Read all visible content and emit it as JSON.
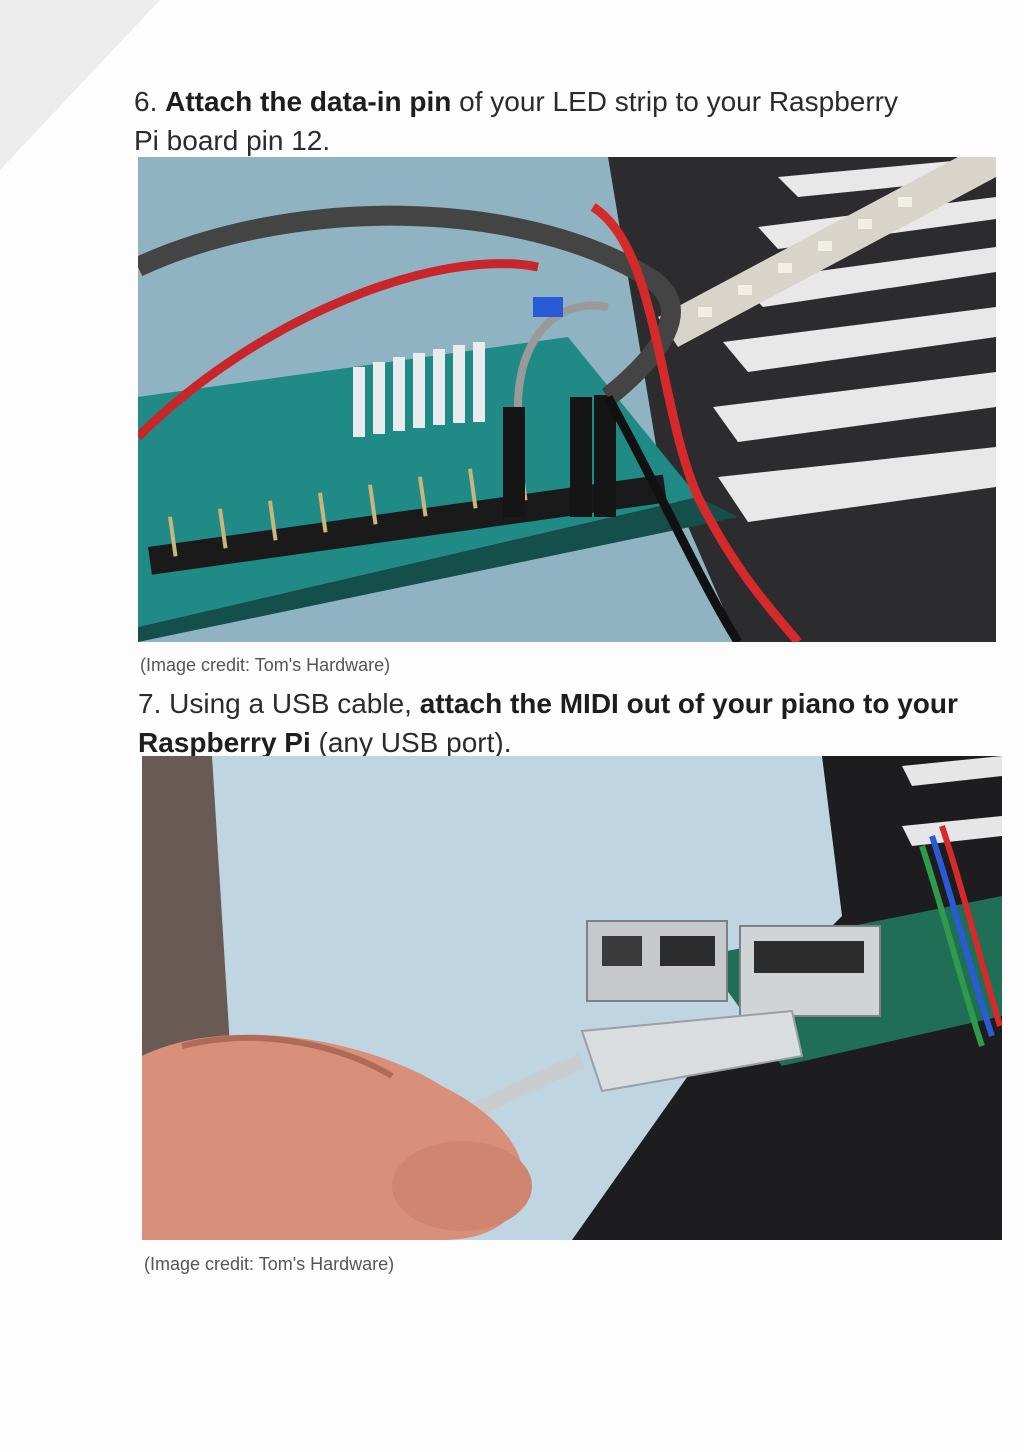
{
  "step6": {
    "number": "6.",
    "bold": "Attach the data-in pin",
    "rest": " of your LED strip to your Raspberry Pi board pin 12."
  },
  "step7": {
    "number": "7.",
    "lead": " Using a USB cable, ",
    "bold": "attach the MIDI out of your piano to your Raspberry Pi",
    "rest": " (any USB port)."
  },
  "image1": {
    "subject": "Raspberry Pi GPIO header with LED strip wires connected, piano keys in background",
    "credit": "(Image credit: Tom's Hardware)"
  },
  "image2": {
    "subject": "Hand plugging a USB cable into Raspberry Pi USB port",
    "credit": "(Image credit: Tom's Hardware)"
  },
  "colors": {
    "text": "#2b2b2b",
    "credit": "#555555",
    "pcb": "#1f8a86",
    "wire_red": "#d62a2a",
    "piano": "#2a2a2a"
  }
}
